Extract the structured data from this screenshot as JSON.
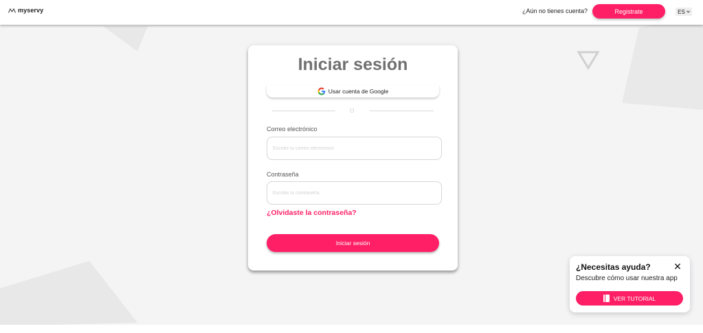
{
  "header": {
    "logo_text": "myservy",
    "no_account_question": "¿Aún no tienes cuenta?",
    "register_label": "Registrate",
    "language": "ES"
  },
  "login": {
    "title": "Iniciar sesión",
    "google_label": "Usar cuenta de Google",
    "divider_text": "O",
    "email_label": "Correo electrónico",
    "email_placeholder": "Escribe tu correo electrónico",
    "password_label": "Contraseña",
    "password_placeholder": "Escribe tu contraseña",
    "forgot_label": "¿Olvidaste la contraseña?",
    "submit_label": "Iniciar sesión"
  },
  "help": {
    "title": "¿Necesitas ayuda?",
    "description": "Descubre cómo usar nuestra app",
    "tutorial_label": "VER TUTORIAL"
  },
  "icons": {
    "logo": "logo-icon",
    "google": "google-icon",
    "chevron": "chevron-down-icon",
    "close": "close-icon",
    "tutorial": "book-icon"
  },
  "colors": {
    "accent": "#ff1f66",
    "title_gray": "#707070",
    "background": "#f4f4f5"
  }
}
